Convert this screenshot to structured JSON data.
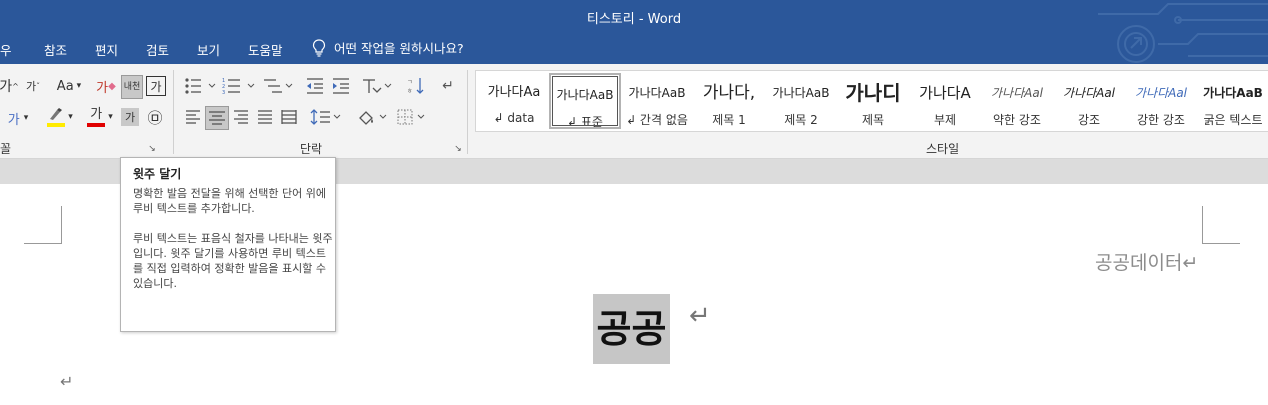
{
  "window": {
    "title": "티스토리  -  Word"
  },
  "menu": {
    "tabs": [
      "우",
      "참조",
      "편지",
      "검토",
      "보기",
      "도움말"
    ],
    "tell_me": "어떤 작업을 원하시나요?"
  },
  "ribbon": {
    "font_group": {
      "label": "꼴",
      "grow_font": "가",
      "shrink_font": "가",
      "change_case": "Aa",
      "clear_format": "가",
      "phonetic_guide": "내천",
      "char_border": "가",
      "text_effects": "가",
      "font_color": "가",
      "char_shading": "가",
      "enclose_char": "㉤"
    },
    "paragraph_group": {
      "label": "단락"
    },
    "styles_group": {
      "label": "스타일",
      "items": [
        {
          "preview": "가나다Aa",
          "name": "↲ data"
        },
        {
          "preview": "가나다AaB",
          "name": "↲ 표준"
        },
        {
          "preview": "가나다AaB",
          "name": "↲ 간격 없음"
        },
        {
          "preview": "가나다,",
          "name": "제목 1"
        },
        {
          "preview": "가나다AaB",
          "name": "제목 2"
        },
        {
          "preview": "가나디",
          "name": "제목"
        },
        {
          "preview": "가나다A",
          "name": "부제"
        },
        {
          "preview": "가나다Aal",
          "name": "약한 강조"
        },
        {
          "preview": "가나다Aal",
          "name": "강조"
        },
        {
          "preview": "가나다Aal",
          "name": "강한 강조"
        },
        {
          "preview": "가나다AaB",
          "name": "굵은 텍스트"
        }
      ]
    }
  },
  "tooltip": {
    "title": "윗주 달기",
    "para1": "명확한 발음 전달을 위해 선택한 단어 위에 루비 텍스트를 추가합니다.",
    "para2": "루비 텍스트는 표음식 철자를 나타내는 윗주입니다. 윗주 달기를 사용하면 루비 텍스트를 직접 입력하여 정확한 발음을 표시할 수 있습니다."
  },
  "document": {
    "header_text": "공공데이터↵",
    "selected_text": "공공",
    "paragraph_mark": "↵",
    "empty_paragraph_mark": "↵"
  },
  "colors": {
    "title_bar": "#2b579a",
    "ribbon_bg": "#f3f3f3",
    "selection": "#c6c6c6",
    "font_color_underline": "#e00000",
    "highlight_underline": "#ffeb00"
  }
}
